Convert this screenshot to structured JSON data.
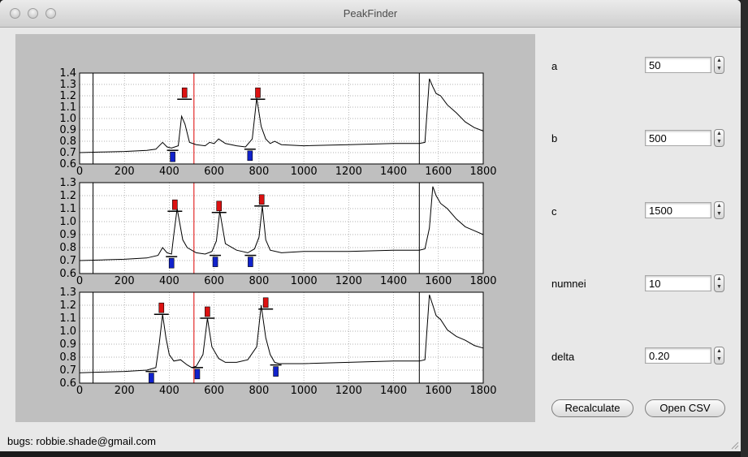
{
  "window": {
    "title": "PeakFinder"
  },
  "controls": [
    {
      "key": "a",
      "label": "a",
      "value": "50"
    },
    {
      "key": "b",
      "label": "b",
      "value": "500"
    },
    {
      "key": "c",
      "label": "c",
      "value": "1500"
    },
    {
      "key": "numnei",
      "label": "numnei",
      "value": "10"
    },
    {
      "key": "delta",
      "label": "delta",
      "value": "0.20"
    }
  ],
  "buttons": {
    "recalculate": "Recalculate",
    "open_csv": "Open CSV"
  },
  "status": {
    "text": "bugs: robbie.shade@gmail.com"
  },
  "icons": {
    "spin_up": "chevron-up-icon",
    "spin_down": "chevron-down-icon",
    "close": "close-icon",
    "minimize": "minimize-icon",
    "zoom": "zoom-icon",
    "resize": "resize-grip-icon"
  },
  "colors": {
    "max_marker": "#dd1111",
    "min_marker": "#1122cc",
    "cursor_line": "#dd0000",
    "plot_background": "#bfbfbf"
  },
  "chart_data": [
    {
      "type": "line",
      "xlim": [
        0,
        1800
      ],
      "ylim": [
        0.6,
        1.4
      ],
      "xticks": [
        0,
        200,
        400,
        600,
        800,
        1000,
        1200,
        1400,
        1600,
        1800
      ],
      "yticks": [
        "0.6",
        "0.7",
        "0.8",
        "0.9",
        "1.0",
        "1.1",
        "1.2",
        "1.3",
        "1.4"
      ],
      "grid": true,
      "vertical_lines": [
        {
          "x": 60,
          "color": "black"
        },
        {
          "x": 510,
          "color": "red"
        },
        {
          "x": 1515,
          "color": "black"
        }
      ],
      "series": [
        {
          "x": [
            0,
            100,
            200,
            300,
            340,
            370,
            390,
            410,
            440,
            455,
            470,
            490,
            520,
            560,
            580,
            600,
            620,
            650,
            700,
            740,
            770,
            790,
            810,
            830,
            850,
            870,
            900,
            1000,
            1200,
            1400,
            1515,
            1540,
            1560,
            1575,
            1590,
            1610,
            1640,
            1680,
            1720,
            1760,
            1800
          ],
          "y": [
            0.7,
            0.705,
            0.71,
            0.72,
            0.73,
            0.79,
            0.75,
            0.74,
            0.76,
            1.02,
            0.95,
            0.79,
            0.77,
            0.76,
            0.79,
            0.78,
            0.82,
            0.78,
            0.76,
            0.75,
            0.82,
            1.18,
            0.93,
            0.82,
            0.78,
            0.8,
            0.77,
            0.76,
            0.77,
            0.78,
            0.78,
            0.79,
            1.35,
            1.28,
            1.22,
            1.2,
            1.12,
            1.05,
            0.97,
            0.92,
            0.89
          ]
        }
      ],
      "maxima": [
        {
          "x": 468,
          "y": 1.17
        },
        {
          "x": 795,
          "y": 1.17
        }
      ],
      "minima": [
        {
          "x": 415,
          "y": 0.72
        },
        {
          "x": 760,
          "y": 0.73
        }
      ]
    },
    {
      "type": "line",
      "xlim": [
        0,
        1800
      ],
      "ylim": [
        0.6,
        1.3
      ],
      "xticks": [
        0,
        200,
        400,
        600,
        800,
        1000,
        1200,
        1400,
        1600,
        1800
      ],
      "yticks": [
        "0.6",
        "0.7",
        "0.8",
        "0.9",
        "1.0",
        "1.1",
        "1.2",
        "1.3"
      ],
      "grid": true,
      "vertical_lines": [
        {
          "x": 60,
          "color": "black"
        },
        {
          "x": 510,
          "color": "red"
        },
        {
          "x": 1515,
          "color": "black"
        }
      ],
      "series": [
        {
          "x": [
            0,
            100,
            200,
            300,
            350,
            370,
            390,
            410,
            420,
            435,
            460,
            480,
            520,
            560,
            590,
            610,
            625,
            650,
            700,
            750,
            780,
            800,
            815,
            830,
            850,
            900,
            1000,
            1200,
            1400,
            1515,
            1540,
            1560,
            1575,
            1590,
            1610,
            1640,
            1680,
            1720,
            1760,
            1800
          ],
          "y": [
            0.7,
            0.705,
            0.71,
            0.72,
            0.74,
            0.8,
            0.76,
            0.75,
            0.9,
            1.1,
            0.86,
            0.8,
            0.76,
            0.75,
            0.77,
            0.85,
            1.08,
            0.83,
            0.78,
            0.76,
            0.79,
            0.88,
            1.12,
            0.86,
            0.78,
            0.76,
            0.77,
            0.77,
            0.78,
            0.78,
            0.79,
            0.95,
            1.27,
            1.2,
            1.14,
            1.1,
            1.02,
            0.96,
            0.93,
            0.9
          ]
        }
      ],
      "maxima": [
        {
          "x": 425,
          "y": 1.08
        },
        {
          "x": 622,
          "y": 1.07
        },
        {
          "x": 812,
          "y": 1.12
        }
      ],
      "minima": [
        {
          "x": 410,
          "y": 0.73
        },
        {
          "x": 605,
          "y": 0.74
        },
        {
          "x": 762,
          "y": 0.74
        }
      ]
    },
    {
      "type": "line",
      "xlim": [
        0,
        1800
      ],
      "ylim": [
        0.6,
        1.3
      ],
      "xticks": [
        0,
        200,
        400,
        600,
        800,
        1000,
        1200,
        1400,
        1600,
        1800
      ],
      "yticks": [
        "0.6",
        "0.7",
        "0.8",
        "0.9",
        "1.0",
        "1.1",
        "1.2",
        "1.3"
      ],
      "grid": true,
      "vertical_lines": [
        {
          "x": 60,
          "color": "black"
        },
        {
          "x": 510,
          "color": "red"
        },
        {
          "x": 1515,
          "color": "black"
        }
      ],
      "series": [
        {
          "x": [
            0,
            100,
            200,
            300,
            340,
            355,
            370,
            385,
            400,
            420,
            450,
            480,
            500,
            520,
            550,
            570,
            590,
            620,
            650,
            700,
            750,
            790,
            810,
            830,
            850,
            870,
            890,
            1000,
            1200,
            1400,
            1515,
            1540,
            1560,
            1575,
            1590,
            1610,
            1640,
            1680,
            1720,
            1760,
            1800
          ],
          "y": [
            0.68,
            0.685,
            0.69,
            0.7,
            0.72,
            0.9,
            1.13,
            0.95,
            0.82,
            0.77,
            0.78,
            0.74,
            0.72,
            0.73,
            0.82,
            1.1,
            0.88,
            0.79,
            0.76,
            0.76,
            0.78,
            0.88,
            1.2,
            0.95,
            0.82,
            0.76,
            0.75,
            0.75,
            0.76,
            0.77,
            0.77,
            0.78,
            1.28,
            1.2,
            1.12,
            1.09,
            1.01,
            0.96,
            0.93,
            0.89,
            0.87
          ]
        }
      ],
      "maxima": [
        {
          "x": 365,
          "y": 1.13
        },
        {
          "x": 570,
          "y": 1.1
        },
        {
          "x": 830,
          "y": 1.17
        }
      ],
      "minima": [
        {
          "x": 320,
          "y": 0.69
        },
        {
          "x": 525,
          "y": 0.72
        },
        {
          "x": 875,
          "y": 0.74
        }
      ]
    }
  ]
}
